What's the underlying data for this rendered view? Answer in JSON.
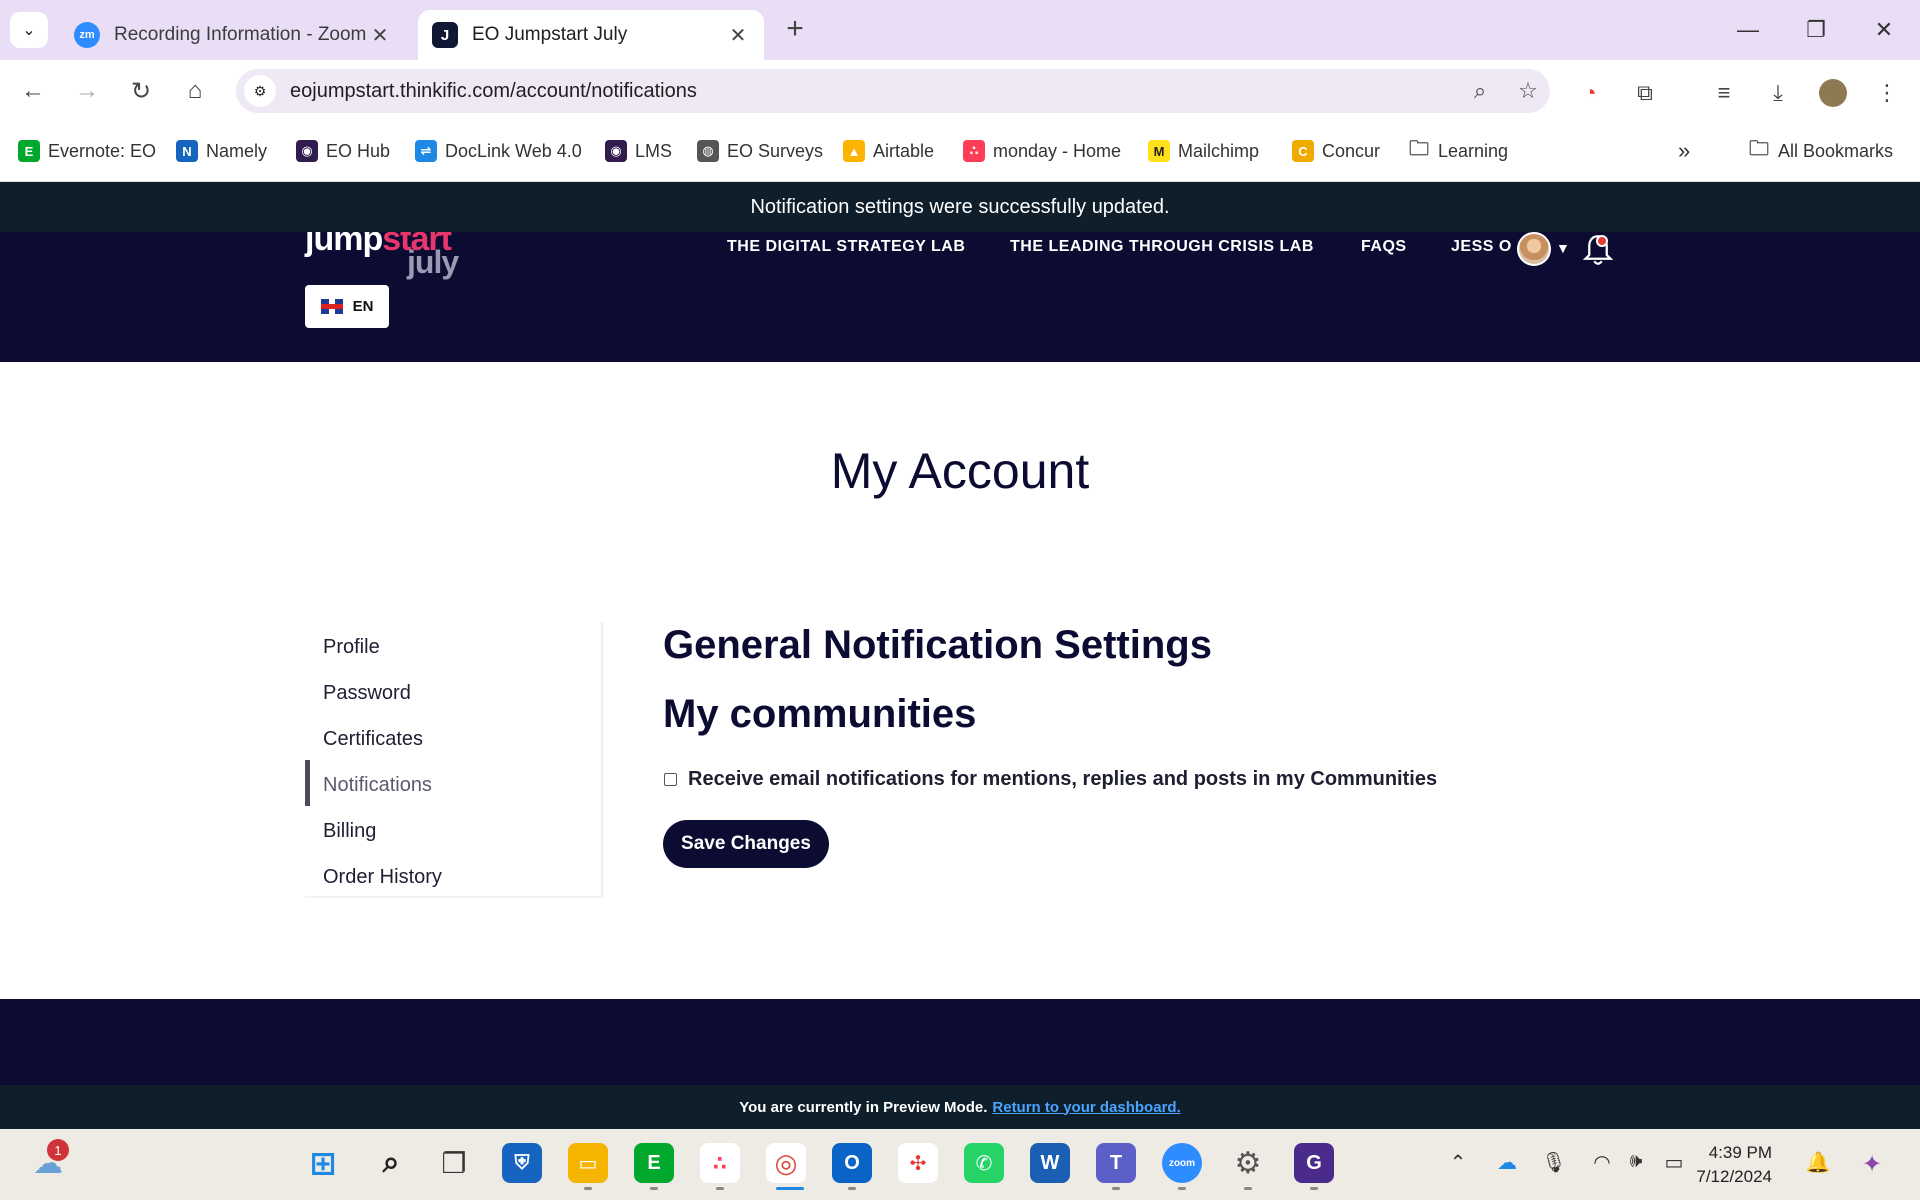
{
  "browser": {
    "tabs": [
      {
        "title": "Recording Information - Zoom",
        "favicon": "zm",
        "active": false
      },
      {
        "title": "EO Jumpstart July",
        "favicon": "J",
        "active": true
      }
    ],
    "url": "eojumpstart.thinkific.com/account/notifications",
    "bookmarks": [
      {
        "label": "Evernote: EO",
        "icon": "evernote-icon",
        "color": "#00a82d"
      },
      {
        "label": "Namely",
        "icon": "namely-icon",
        "color": "#1565c0"
      },
      {
        "label": "EO Hub",
        "icon": "eo-icon",
        "color": "#311b4f"
      },
      {
        "label": "DocLink Web 4.0",
        "icon": "doclink-icon",
        "color": "#1e88e5"
      },
      {
        "label": "LMS",
        "icon": "eo-icon",
        "color": "#311b4f"
      },
      {
        "label": "EO Surveys",
        "icon": "globe-icon",
        "color": "#555555"
      },
      {
        "label": "Airtable",
        "icon": "airtable-icon",
        "color": "#fcb400"
      },
      {
        "label": "monday - Home",
        "icon": "monday-icon",
        "color": "#ff3d57"
      },
      {
        "label": "Mailchimp",
        "icon": "mailchimp-icon",
        "color": "#ffe01b"
      },
      {
        "label": "Concur",
        "icon": "concur-icon",
        "color": "#f0ab00"
      },
      {
        "label": "Learning",
        "icon": "folder-icon",
        "color": "#555555"
      }
    ],
    "all_bookmarks": "All Bookmarks"
  },
  "flash_message": "Notification settings were successfully updated.",
  "header": {
    "logo_jump": "jump",
    "logo_start": "start",
    "logo_july": "july",
    "language": "EN",
    "nav": [
      "THE DIGITAL STRATEGY LAB",
      "THE LEADING THROUGH CRISIS LAB",
      "FAQS"
    ],
    "user": "JESS O"
  },
  "page_title": "My Account",
  "sidebar": {
    "items": [
      "Profile",
      "Password",
      "Certificates",
      "Notifications",
      "Billing",
      "Order History"
    ],
    "active": "Notifications"
  },
  "main": {
    "heading": "General Notification Settings",
    "subheading": "My communities",
    "checkbox_label": "Receive email notifications for mentions, replies and posts in my Communities",
    "checkbox_checked": false,
    "save_label": "Save Changes"
  },
  "preview": {
    "text": "You are currently in Preview Mode.",
    "link": "Return to your dashboard."
  },
  "taskbar": {
    "weather_badge": "1",
    "time": "4:39 PM",
    "date": "7/12/2024"
  },
  "colors": {
    "header_bg": "#0c0c33",
    "flash_bg": "#0e1e2b",
    "logo_accent": "#e8366a"
  }
}
